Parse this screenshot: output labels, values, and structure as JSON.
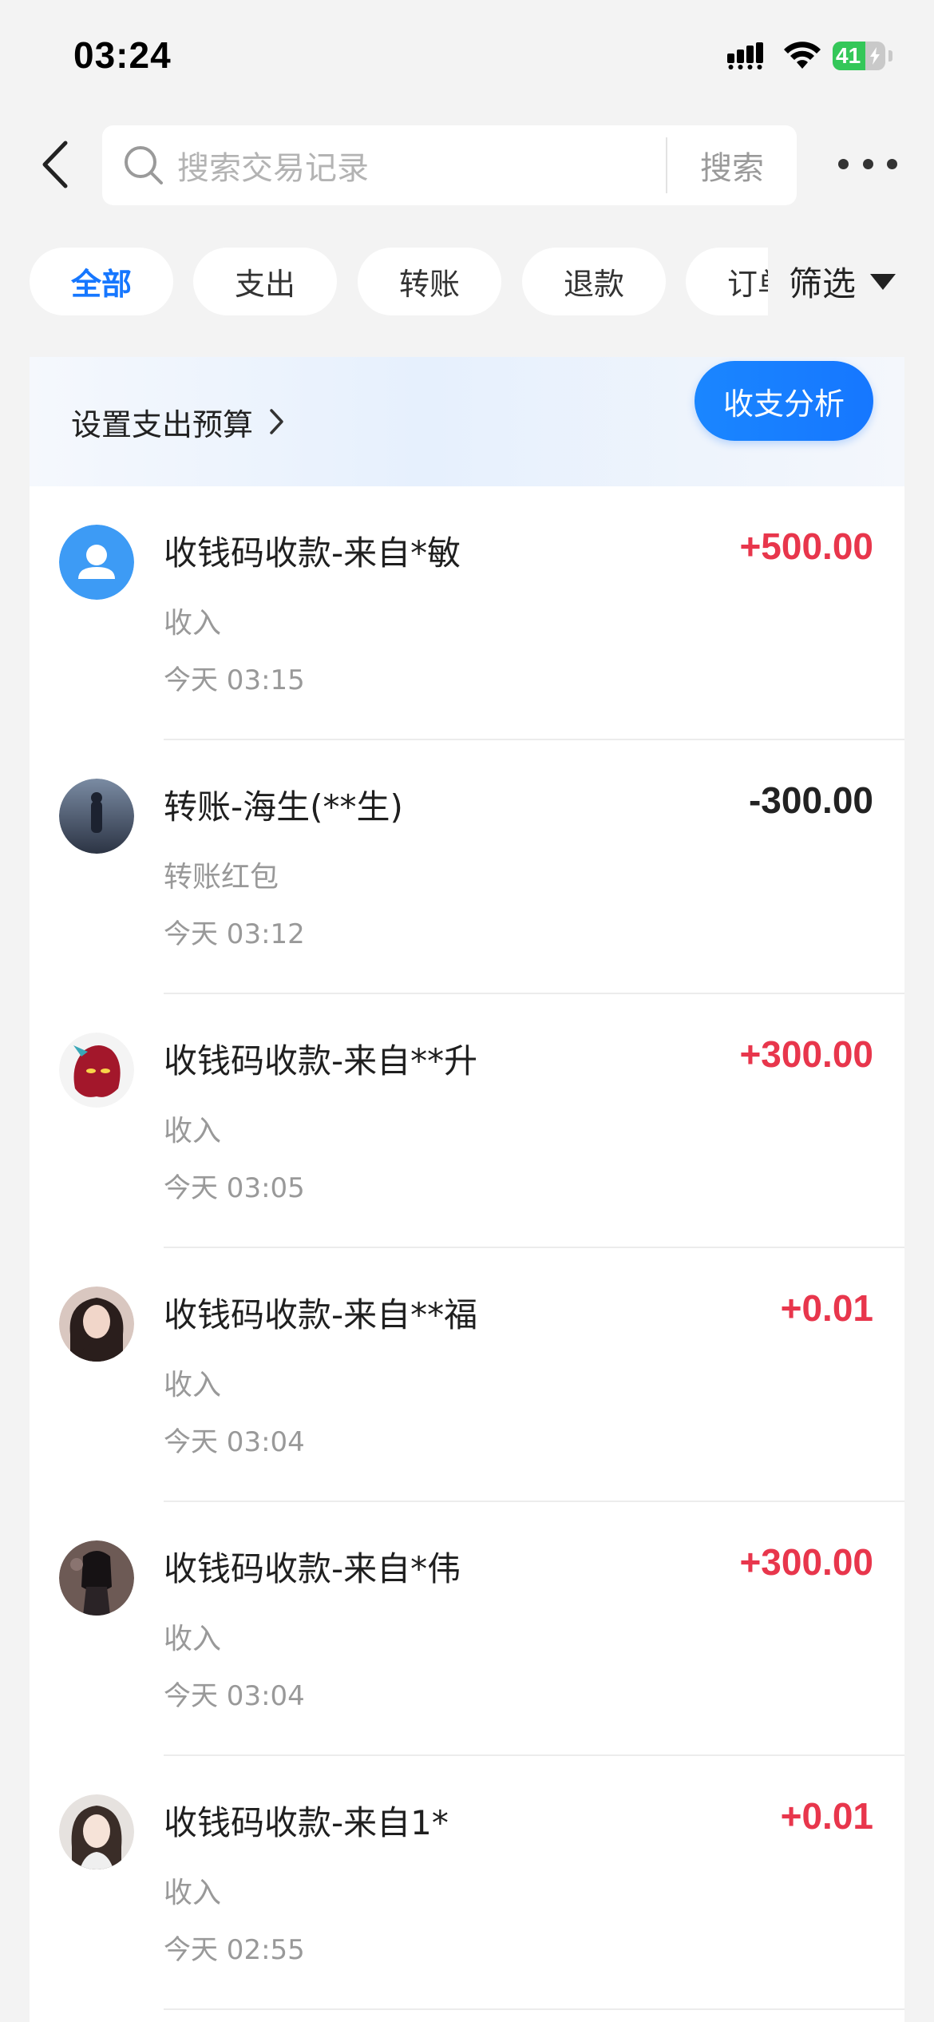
{
  "status_bar": {
    "time": "03:24",
    "battery_level": "41",
    "icons": [
      "cellular-signal-icon",
      "wifi-icon",
      "battery-charging-icon"
    ]
  },
  "header": {
    "search_placeholder": "搜索交易记录",
    "search_button": "搜索",
    "icons": [
      "back-arrow-icon",
      "search-icon",
      "more-icon"
    ]
  },
  "tabs": [
    "全部",
    "支出",
    "转账",
    "退款",
    "订单"
  ],
  "active_tab": "全部",
  "filter_label": "筛选",
  "budget": {
    "link_label": "设置支出预算",
    "analysis_button": "收支分析"
  },
  "colors": {
    "accent": "#1677ff",
    "income": "#e8364c",
    "expense": "#222222"
  },
  "transactions": [
    {
      "title": "收钱码收款-来自*敏",
      "category": "收入",
      "time": "今天 03:15",
      "amount": "+500.00",
      "type": "income",
      "avatar": "default-user-icon"
    },
    {
      "title": "转账-海生(**生)",
      "category": "转账红包",
      "time": "今天 03:12",
      "amount": "-300.00",
      "type": "expense",
      "avatar": "photo-avatar"
    },
    {
      "title": "收钱码收款-来自**升",
      "category": "收入",
      "time": "今天 03:05",
      "amount": "+300.00",
      "type": "income",
      "avatar": "photo-avatar"
    },
    {
      "title": "收钱码收款-来自**福",
      "category": "收入",
      "time": "今天 03:04",
      "amount": "+0.01",
      "type": "income",
      "avatar": "photo-avatar"
    },
    {
      "title": "收钱码收款-来自*伟",
      "category": "收入",
      "time": "今天 03:04",
      "amount": "+300.00",
      "type": "income",
      "avatar": "photo-avatar"
    },
    {
      "title": "收钱码收款-来自1*",
      "category": "收入",
      "time": "今天 02:55",
      "amount": "+0.01",
      "type": "income",
      "avatar": "photo-avatar"
    }
  ]
}
